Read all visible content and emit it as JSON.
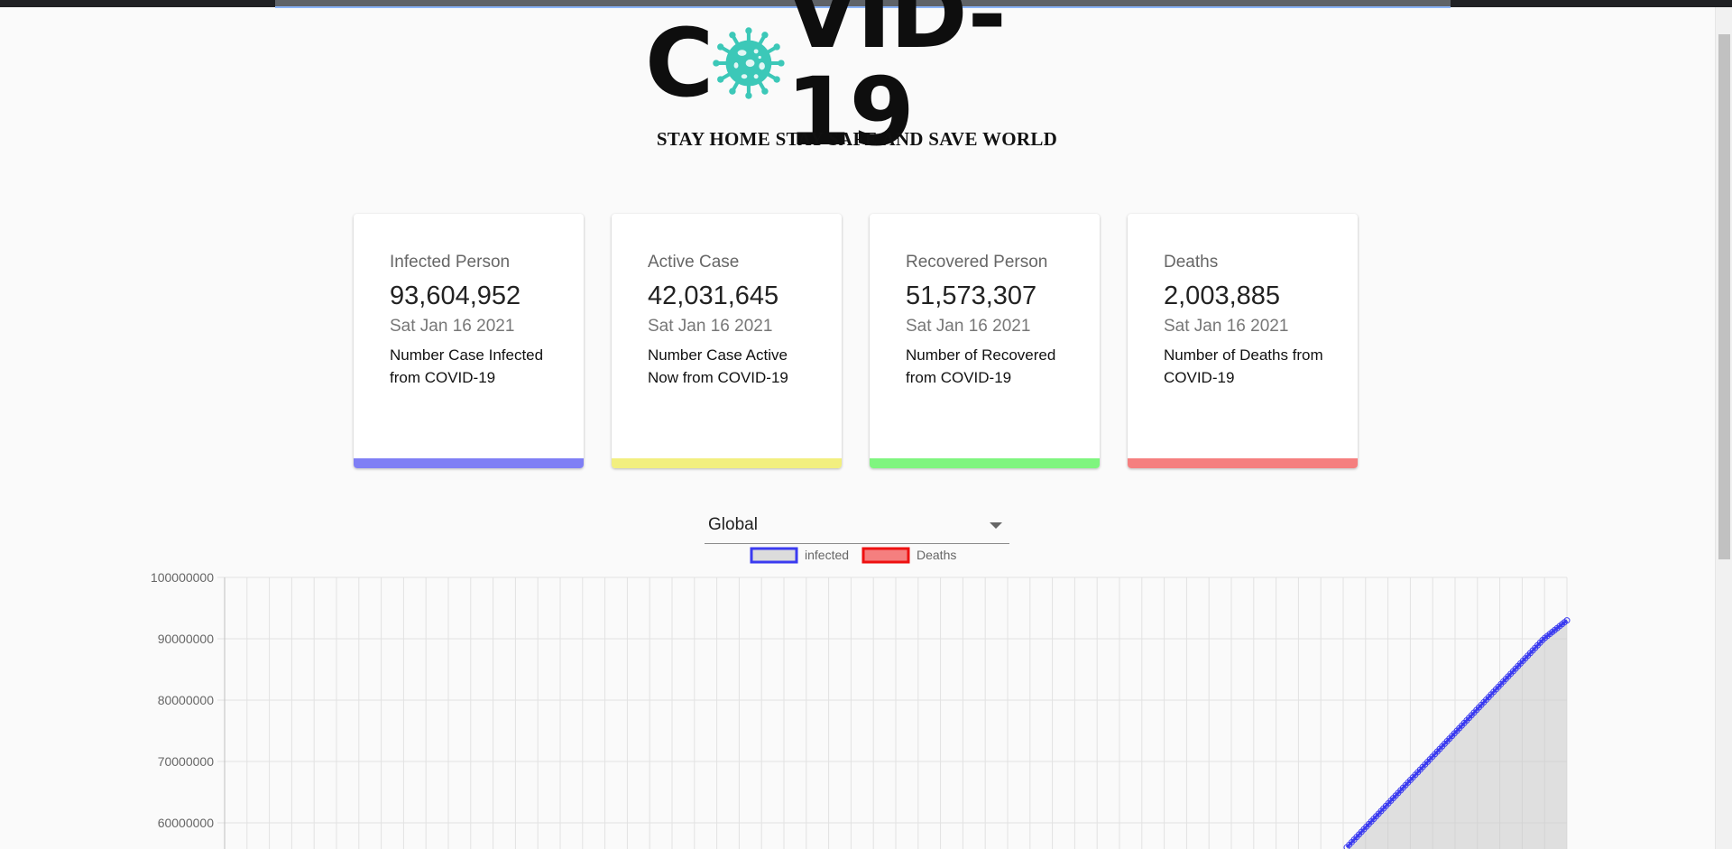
{
  "logo": {
    "text_left": "C",
    "text_right": "VID-19",
    "virus_icon": "virus-icon",
    "virus_color": "#3cc8b8"
  },
  "slogan": "STAY HOME STAY SAFE AND SAVE WORLD",
  "cards": [
    {
      "title": "Infected Person",
      "value": "93,604,952",
      "date": "Sat Jan 16 2021",
      "desc": "Number Case Infected from COVID-19",
      "bar_color": "#7f7ff5"
    },
    {
      "title": "Active Case",
      "value": "42,031,645",
      "date": "Sat Jan 16 2021",
      "desc": "Number Case Active Now from COVID-19",
      "bar_color": "#f2ef7f"
    },
    {
      "title": "Recovered Person",
      "value": "51,573,307",
      "date": "Sat Jan 16 2021",
      "desc": "Number of Recovered from COVID-19",
      "bar_color": "#7ff57f"
    },
    {
      "title": "Deaths",
      "value": "2,003,885",
      "date": "Sat Jan 16 2021",
      "desc": "Number of Deaths from COVID-19",
      "bar_color": "#f57f7f"
    }
  ],
  "country_select": {
    "value": "Global"
  },
  "chart_data": {
    "type": "line",
    "legend": [
      {
        "name": "infected",
        "fill": "#dcdcdc",
        "stroke": "#3b3bf0"
      },
      {
        "name": "Deaths",
        "fill": "#f57f7f",
        "stroke": "#ee1111"
      }
    ],
    "legend_position": "top-center",
    "y_ticks": [
      "100000000",
      "90000000",
      "80000000",
      "70000000",
      "60000000"
    ],
    "ylim_visible": [
      56000000,
      100000000
    ],
    "grid": true,
    "series": [
      {
        "name": "infected",
        "fill": true,
        "values_tail": [
          56000000,
          58000000,
          60000000,
          62000000,
          64000000,
          66000000,
          68000000,
          70000000,
          72000000,
          74000000,
          76000000,
          78000000,
          80000000,
          82000000,
          84000000,
          86000000,
          88000000,
          90000000,
          91500000,
          93000000
        ]
      },
      {
        "name": "Deaths",
        "fill": true,
        "values_tail": []
      }
    ]
  }
}
